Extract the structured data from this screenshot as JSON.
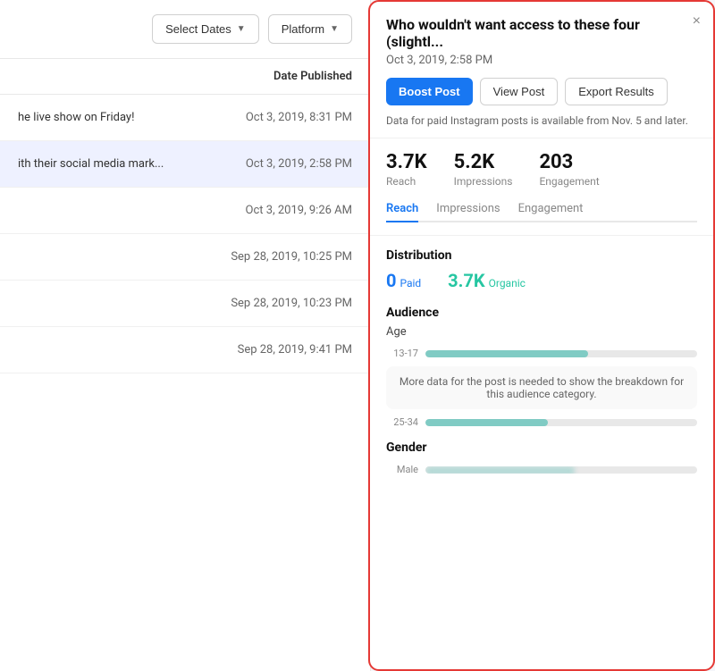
{
  "toolbar": {
    "select_dates_label": "Select Dates",
    "platform_label": "Platform"
  },
  "table": {
    "header_label": "Date Published",
    "rows": [
      {
        "title": "he live show on Friday!",
        "date": "Oct 3, 2019, 8:31 PM",
        "selected": false
      },
      {
        "title": "ith their social media mark...",
        "date": "Oct 3, 2019, 2:58 PM",
        "selected": true
      },
      {
        "title": "",
        "date": "Oct 3, 2019, 9:26 AM",
        "selected": false
      },
      {
        "title": "",
        "date": "Sep 28, 2019, 10:25 PM",
        "selected": false
      },
      {
        "title": "",
        "date": "Sep 28, 2019, 10:23 PM",
        "selected": false
      },
      {
        "title": "",
        "date": "Sep 28, 2019, 9:41 PM",
        "selected": false
      }
    ]
  },
  "detail_panel": {
    "title": "Who wouldn't want access to these four (slightl...",
    "date": "Oct 3, 2019, 2:58 PM",
    "buttons": {
      "boost": "Boost Post",
      "view": "View Post",
      "export": "Export Results"
    },
    "notice": "Data for paid Instagram posts is available from Nov. 5 and later.",
    "stats": {
      "reach_value": "3.7K",
      "reach_label": "Reach",
      "impressions_value": "5.2K",
      "impressions_label": "Impressions",
      "engagement_value": "203",
      "engagement_label": "Engagement"
    },
    "active_tab": "Reach",
    "distribution": {
      "label": "Distribution",
      "paid_value": "0",
      "paid_label": "Paid",
      "organic_value": "3.7K",
      "organic_label": "Organic"
    },
    "audience": {
      "label": "Audience",
      "age_label": "Age",
      "age_bars": [
        {
          "range": "13-17",
          "fill_percent": 60
        },
        {
          "range": "25-34",
          "fill_percent": 45
        }
      ],
      "more_data_notice": "More data for the post is needed to show the breakdown for this audience category.",
      "gender_label": "Gender",
      "gender_bars": [
        {
          "name": "Male",
          "fill_percent": 55
        }
      ]
    },
    "close_label": "×"
  }
}
